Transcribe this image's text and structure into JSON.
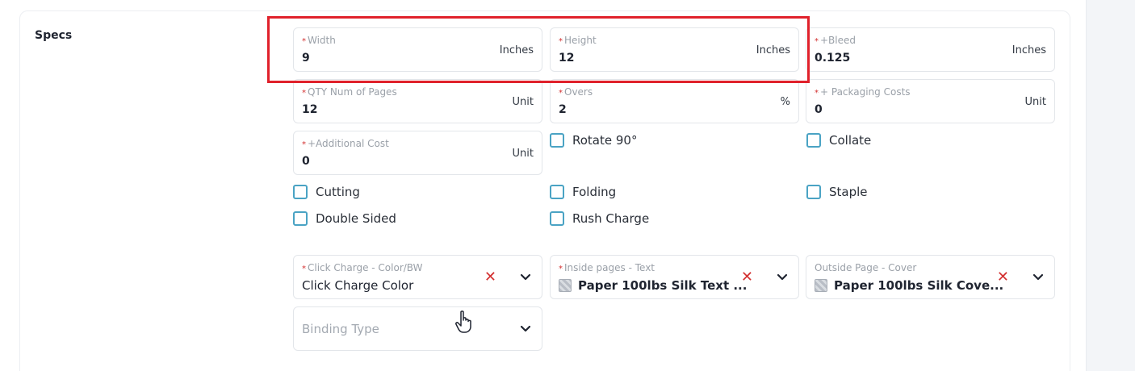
{
  "section": {
    "title": "Specs"
  },
  "fields": {
    "width": {
      "label": "Width",
      "value": "9",
      "unit": "Inches"
    },
    "height": {
      "label": "Height",
      "value": "12",
      "unit": "Inches"
    },
    "bleed": {
      "label": "+Bleed",
      "value": "0.125",
      "unit": "Inches"
    },
    "qty_pages": {
      "label": "QTY Num of Pages",
      "value": "12",
      "unit": "Unit"
    },
    "overs": {
      "label": "Overs",
      "value": "2",
      "unit": "%"
    },
    "packaging": {
      "label": "+ Packaging Costs",
      "value": "0",
      "unit": "Unit"
    },
    "additional": {
      "label": "+Additional Cost",
      "value": "0",
      "unit": "Unit"
    }
  },
  "checkboxes": {
    "rotate": "Rotate 90°",
    "collate": "Collate",
    "cutting": "Cutting",
    "folding": "Folding",
    "staple": "Staple",
    "double_sided": "Double Sided",
    "rush": "Rush Charge"
  },
  "selects": {
    "click_charge": {
      "label": "Click Charge - Color/BW",
      "value": "Click Charge Color"
    },
    "inside_pages": {
      "label": "Inside pages - Text",
      "value": "Paper 100lbs Silk Text ..."
    },
    "outside_page": {
      "label": "Outside Page - Cover",
      "value": "Paper 100lbs Silk Cove..."
    },
    "binding": {
      "placeholder": "Binding Type"
    }
  },
  "colors": {
    "required": "#d32f2f",
    "checkbox": "#4aa3c4",
    "highlight": "#e0212b"
  },
  "icons": {
    "clear": "x-icon",
    "dropdown": "chevron-down-icon",
    "thumbnail": "image-icon",
    "cursor": "hand-pointer-icon"
  }
}
